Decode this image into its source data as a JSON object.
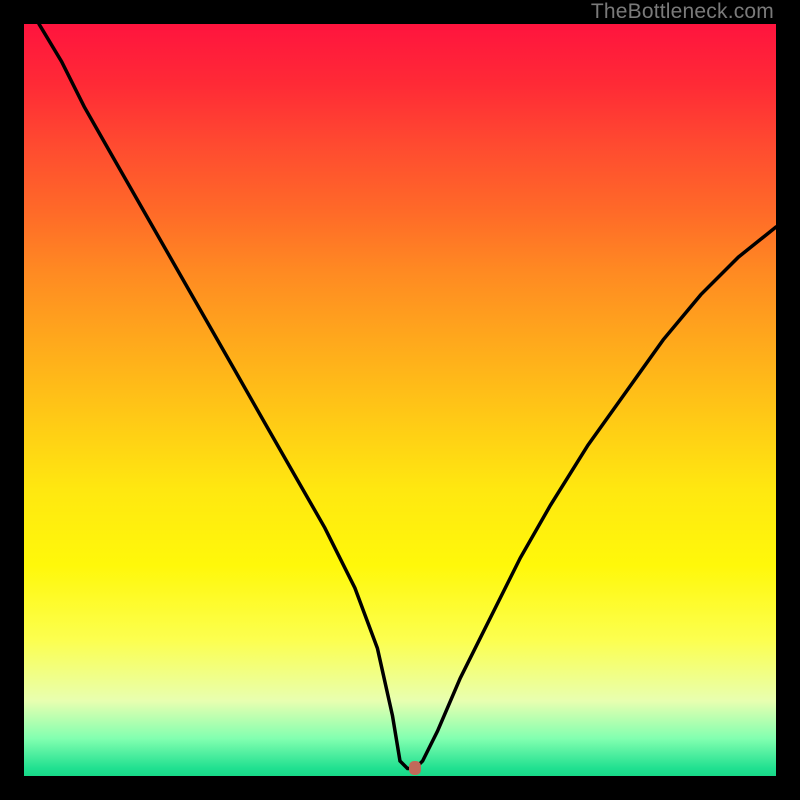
{
  "watermark": "TheBottleneck.com",
  "chart_data": {
    "type": "line",
    "title": "",
    "xlabel": "",
    "ylabel": "",
    "xlim": [
      0,
      100
    ],
    "ylim": [
      0,
      100
    ],
    "grid": false,
    "series": [
      {
        "name": "bottleneck-curve",
        "x": [
          2,
          5,
          8,
          12,
          16,
          20,
          24,
          28,
          32,
          36,
          40,
          44,
          47,
          49,
          50,
          51,
          52,
          53,
          55,
          58,
          62,
          66,
          70,
          75,
          80,
          85,
          90,
          95,
          100
        ],
        "y": [
          100,
          95,
          89,
          82,
          75,
          68,
          61,
          54,
          47,
          40,
          33,
          25,
          17,
          8,
          2,
          1,
          1,
          2,
          6,
          13,
          21,
          29,
          36,
          44,
          51,
          58,
          64,
          69,
          73
        ]
      }
    ],
    "marker": {
      "x": 52,
      "y": 1,
      "color": "#c16a5a"
    },
    "colors": {
      "background_gradient_top": "#ff143e",
      "background_gradient_bottom": "#18d888",
      "curve": "#000000",
      "frame": "#000000"
    }
  }
}
